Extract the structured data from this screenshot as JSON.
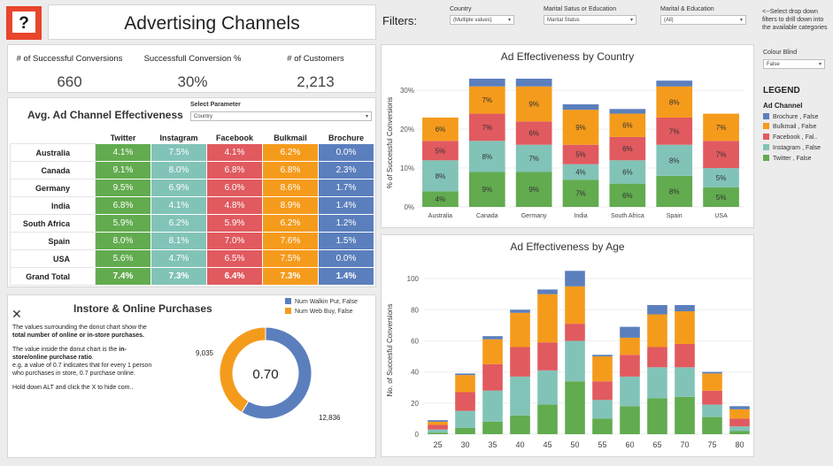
{
  "header": {
    "title": "Advertising Channels",
    "filters_label": "Filters:"
  },
  "filters": [
    {
      "label": "Country",
      "value": "(Multiple values)"
    },
    {
      "label": "Marital Satus or Education",
      "value": "Marital Status"
    },
    {
      "label": "Marital & Education",
      "value": "(All)"
    }
  ],
  "hint": "<--Select drop down filters to drill down into the available categories",
  "colour_blind": {
    "label": "Colour Blind",
    "value": "False"
  },
  "legend": {
    "title": "LEGEND",
    "subtitle": "Ad Channel",
    "items": [
      {
        "label": "Brochure , False",
        "color": "#5b7fbd"
      },
      {
        "label": "Bulkmail , False",
        "color": "#f59b1c"
      },
      {
        "label": "Facebook , Fal..",
        "color": "#e15a5f"
      },
      {
        "label": "Instagram , False",
        "color": "#82c3b8"
      },
      {
        "label": "Twitter , False",
        "color": "#62ab4f"
      }
    ]
  },
  "kpis": [
    {
      "label": "# of Successful Conversions",
      "value": "660"
    },
    {
      "label": "Successfull Conversion %",
      "value": "30%"
    },
    {
      "label": "# of Customers",
      "value": "2,213"
    }
  ],
  "heatmap": {
    "title": "Avg. Ad Channel Effectiveness",
    "param_label": "Select Parameter",
    "param_value": "Country",
    "columns": [
      "Twitter",
      "Instagram",
      "Facebook",
      "Bulkmail",
      "Brochure"
    ],
    "rows": [
      {
        "label": "Australia",
        "values": [
          "4.1%",
          "7.5%",
          "4.1%",
          "6.2%",
          "0.0%"
        ]
      },
      {
        "label": "Canada",
        "values": [
          "9.1%",
          "8.0%",
          "6.8%",
          "6.8%",
          "2.3%"
        ]
      },
      {
        "label": "Germany",
        "values": [
          "9.5%",
          "6.9%",
          "6.0%",
          "8.6%",
          "1.7%"
        ]
      },
      {
        "label": "India",
        "values": [
          "6.8%",
          "4.1%",
          "4.8%",
          "8.9%",
          "1.4%"
        ]
      },
      {
        "label": "South Africa",
        "values": [
          "5.9%",
          "6.2%",
          "5.9%",
          "6.2%",
          "1.2%"
        ]
      },
      {
        "label": "Spain",
        "values": [
          "8.0%",
          "8.1%",
          "7.0%",
          "7.6%",
          "1.5%"
        ]
      },
      {
        "label": "USA",
        "values": [
          "5.6%",
          "4.7%",
          "6.5%",
          "7.5%",
          "0.0%"
        ]
      },
      {
        "label": "Grand Total",
        "values": [
          "7.4%",
          "7.3%",
          "6.4%",
          "7.3%",
          "1.4%"
        ]
      }
    ]
  },
  "instore": {
    "title": "Instore & Online Purchases",
    "close_symbol": "✕",
    "p1_pre": "The values surrounding the donut chart show the ",
    "p1_bold": "total number of online or in-store purchases.",
    "p2_pre": "The value inside the donut chart is the ",
    "p2_bold": "in-store/online purchase ratio",
    "p2_post": ".",
    "p3": "e.g. a value of 0.7 indicates that for every 1 person who purchases in store, 0.7 purchase online.",
    "p4": "Hold down ALT and click the X to hide com..",
    "legend": [
      {
        "label": "Num Walkin Pur, False",
        "color": "#5b7fbd"
      },
      {
        "label": "Num Web Buy, False",
        "color": "#f59b1c"
      }
    ]
  },
  "chart_data": [
    {
      "type": "bar",
      "title": "Ad Effectiveness by Country",
      "ylabel": "% of Successful Conversions",
      "xlabel": "",
      "stacked": true,
      "categories": [
        "Australia",
        "Canada",
        "Germany",
        "India",
        "South Africa",
        "Spain",
        "USA"
      ],
      "ylim": [
        0,
        33
      ],
      "yticks": [
        0,
        10,
        20,
        30
      ],
      "ytick_labels": [
        "0%",
        "10%",
        "20%",
        "30%"
      ],
      "series": [
        {
          "name": "Twitter",
          "color": "#62ab4f",
          "values": [
            4,
            9,
            9,
            7,
            6,
            8,
            5
          ],
          "labels": [
            "4%",
            "9%",
            "9%",
            "7%",
            "6%",
            "8%",
            "5%"
          ]
        },
        {
          "name": "Instagram",
          "color": "#82c3b8",
          "values": [
            8,
            8,
            7,
            4,
            6,
            8,
            5
          ],
          "labels": [
            "8%",
            "8%",
            "7%",
            "4%",
            "6%",
            "8%",
            "5%"
          ]
        },
        {
          "name": "Facebook",
          "color": "#e15a5f",
          "values": [
            5,
            7,
            6,
            5,
            6,
            7,
            7
          ],
          "labels": [
            "5%",
            "7%",
            "6%",
            "5%",
            "6%",
            "7%",
            "7%"
          ]
        },
        {
          "name": "Bulkmail",
          "color": "#f59b1c",
          "values": [
            6,
            7,
            9,
            9,
            6,
            8,
            7
          ],
          "labels": [
            "6%",
            "7%",
            "9%",
            "9%",
            "6%",
            "8%",
            "7%"
          ]
        },
        {
          "name": "Brochure",
          "color": "#5b7fbd",
          "values": [
            0,
            2,
            2,
            1.4,
            1.2,
            1.5,
            0
          ],
          "labels": [
            "",
            "",
            "",
            "",
            "",
            "",
            ""
          ]
        }
      ]
    },
    {
      "type": "bar",
      "title": "Ad Effectiveness by Age",
      "ylabel": "No. of Succesful Conversions",
      "xlabel": "",
      "stacked": true,
      "categories": [
        "25",
        "30",
        "35",
        "40",
        "45",
        "50",
        "55",
        "60",
        "65",
        "70",
        "75",
        "80"
      ],
      "ylim": [
        0,
        108
      ],
      "yticks": [
        0,
        20,
        40,
        60,
        80,
        100
      ],
      "series": [
        {
          "name": "Twitter",
          "color": "#62ab4f",
          "values": [
            1,
            4,
            8,
            12,
            19,
            34,
            10,
            18,
            23,
            24,
            11,
            2,
            0
          ]
        },
        {
          "name": "Instagram",
          "color": "#82c3b8",
          "values": [
            2,
            11,
            20,
            25,
            22,
            26,
            12,
            19,
            20,
            19,
            8,
            3,
            0
          ]
        },
        {
          "name": "Facebook",
          "color": "#e15a5f",
          "values": [
            3,
            12,
            17,
            19,
            18,
            11,
            12,
            14,
            13,
            15,
            9,
            5,
            0
          ]
        },
        {
          "name": "Bulkmail",
          "color": "#f59b1c",
          "values": [
            2,
            11,
            16,
            22,
            31,
            24,
            16,
            11,
            21,
            21,
            11,
            6,
            0
          ]
        },
        {
          "name": "Brochure",
          "color": "#5b7fbd",
          "values": [
            1,
            1,
            2,
            2,
            3,
            10,
            1,
            7,
            6,
            4,
            1,
            2,
            0.5
          ]
        }
      ]
    },
    {
      "type": "pie",
      "donut": true,
      "center_label": "0.70",
      "slices": [
        {
          "name": "Num Walkin Pur, False",
          "value": 12836,
          "label": "12,836",
          "color": "#5b7fbd"
        },
        {
          "name": "Num Web Buy, False",
          "value": 9035,
          "label": "9,035",
          "color": "#f59b1c"
        }
      ]
    }
  ]
}
